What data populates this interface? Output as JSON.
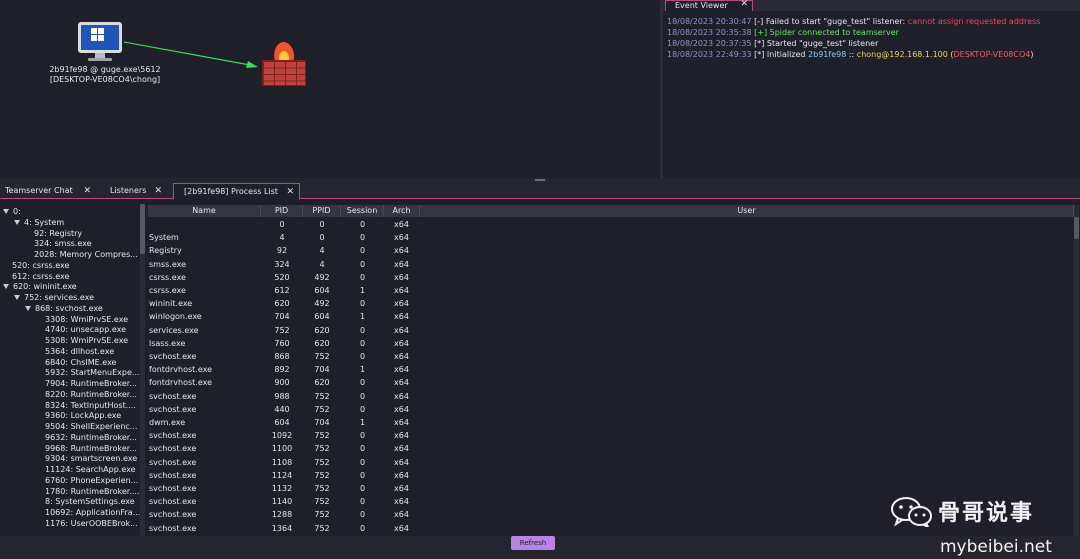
{
  "graph": {
    "session_label_line1": "2b91fe98 @ guge.exe\\5612",
    "session_label_line2": "[DESKTOP-VE08CO4\\chong]",
    "colors": {
      "arrow": "#3ddc5a",
      "firewall_wall": "#c2413a",
      "flame": "#f0542b"
    }
  },
  "event_viewer": {
    "tab_label": "Event Viewer",
    "close_glyph": "✕",
    "events": [
      {
        "ts": "18/08/2023 20:30:47",
        "prefix": "[-]",
        "text_a": " Failed to start \"guge_test\" listener: ",
        "text_b": "cannot assign requested address"
      },
      {
        "ts": "18/08/2023 20:35:38",
        "prefix": "[+]",
        "text_a": " 5pider connected to teamserver"
      },
      {
        "ts": "18/08/2023 20:37:35",
        "prefix": "[*]",
        "text_a": " Started \"guge_test\" listener"
      },
      {
        "ts": "18/08/2023 22:49:33",
        "prefix": "[*]",
        "text_a": " Initialized ",
        "agent": "2b91fe98",
        "sep": " :: ",
        "user": "chong@192.168.1.100",
        "host_open": " (",
        "host": "DESKTOP-VE08CO4",
        "host_close": ")"
      }
    ]
  },
  "tabs": [
    {
      "label": "Teamserver Chat",
      "close": "✕"
    },
    {
      "label": "Listeners",
      "close": "✕"
    },
    {
      "label": "[2b91fe98] Process List",
      "close": "✕"
    }
  ],
  "tree": [
    {
      "label": "0:",
      "expanded": true
    },
    {
      "label": "4: System",
      "expanded": true
    },
    {
      "label": "92: Registry"
    },
    {
      "label": "324: smss.exe"
    },
    {
      "label": "2028: Memory Compres..."
    },
    {
      "label": "520: csrss.exe"
    },
    {
      "label": "612: csrss.exe"
    },
    {
      "label": "620: wininit.exe",
      "expanded": true
    },
    {
      "label": "752: services.exe",
      "expanded": true
    },
    {
      "label": "868: svchost.exe",
      "expanded": true
    },
    {
      "label": "3308: WmiPrvSE.exe"
    },
    {
      "label": "4740: unsecapp.exe"
    },
    {
      "label": "5308: WmiPrvSE.exe"
    },
    {
      "label": "5364: dllhost.exe"
    },
    {
      "label": "6840: ChsIME.exe"
    },
    {
      "label": "5932: StartMenuExpe..."
    },
    {
      "label": "7904: RuntimeBroker..."
    },
    {
      "label": "8220: RuntimeBroker..."
    },
    {
      "label": "8324: TextInputHost...."
    },
    {
      "label": "9360: LockApp.exe"
    },
    {
      "label": "9504: ShellExperienc..."
    },
    {
      "label": "9632: RuntimeBroker..."
    },
    {
      "label": "9968: RuntimeBroker..."
    },
    {
      "label": "9304: smartscreen.exe"
    },
    {
      "label": "11124: SearchApp.exe"
    },
    {
      "label": "6760: PhoneExperien..."
    },
    {
      "label": "1780: RuntimeBroker...."
    },
    {
      "label": "8: SystemSettings.exe"
    },
    {
      "label": "10692: ApplicationFra..."
    },
    {
      "label": "1176: UserOOBEBrok..."
    }
  ],
  "table": {
    "columns": [
      "Name",
      "PID",
      "PPID",
      "Session",
      "Arch",
      "User"
    ],
    "rows": [
      [
        "",
        "0",
        "0",
        "0",
        "x64",
        ""
      ],
      [
        "System",
        "4",
        "0",
        "0",
        "x64",
        ""
      ],
      [
        "Registry",
        "92",
        "4",
        "0",
        "x64",
        ""
      ],
      [
        "smss.exe",
        "324",
        "4",
        "0",
        "x64",
        ""
      ],
      [
        "csrss.exe",
        "520",
        "492",
        "0",
        "x64",
        ""
      ],
      [
        "csrss.exe",
        "612",
        "604",
        "1",
        "x64",
        ""
      ],
      [
        "wininit.exe",
        "620",
        "492",
        "0",
        "x64",
        ""
      ],
      [
        "winlogon.exe",
        "704",
        "604",
        "1",
        "x64",
        ""
      ],
      [
        "services.exe",
        "752",
        "620",
        "0",
        "x64",
        ""
      ],
      [
        "lsass.exe",
        "760",
        "620",
        "0",
        "x64",
        ""
      ],
      [
        "svchost.exe",
        "868",
        "752",
        "0",
        "x64",
        ""
      ],
      [
        "fontdrvhost.exe",
        "892",
        "704",
        "1",
        "x64",
        ""
      ],
      [
        "fontdrvhost.exe",
        "900",
        "620",
        "0",
        "x64",
        ""
      ],
      [
        "svchost.exe",
        "988",
        "752",
        "0",
        "x64",
        ""
      ],
      [
        "svchost.exe",
        "440",
        "752",
        "0",
        "x64",
        ""
      ],
      [
        "dwm.exe",
        "604",
        "704",
        "1",
        "x64",
        ""
      ],
      [
        "svchost.exe",
        "1092",
        "752",
        "0",
        "x64",
        ""
      ],
      [
        "svchost.exe",
        "1100",
        "752",
        "0",
        "x64",
        ""
      ],
      [
        "svchost.exe",
        "1108",
        "752",
        "0",
        "x64",
        ""
      ],
      [
        "svchost.exe",
        "1124",
        "752",
        "0",
        "x64",
        ""
      ],
      [
        "svchost.exe",
        "1132",
        "752",
        "0",
        "x64",
        ""
      ],
      [
        "svchost.exe",
        "1140",
        "752",
        "0",
        "x64",
        ""
      ],
      [
        "svchost.exe",
        "1288",
        "752",
        "0",
        "x64",
        ""
      ],
      [
        "svchost.exe",
        "1364",
        "752",
        "0",
        "x64",
        ""
      ]
    ]
  },
  "refresh_label": "Refresh",
  "watermark": {
    "title": "骨哥说事",
    "url": "mybeibei.net",
    "icon": "wechat-icon"
  }
}
